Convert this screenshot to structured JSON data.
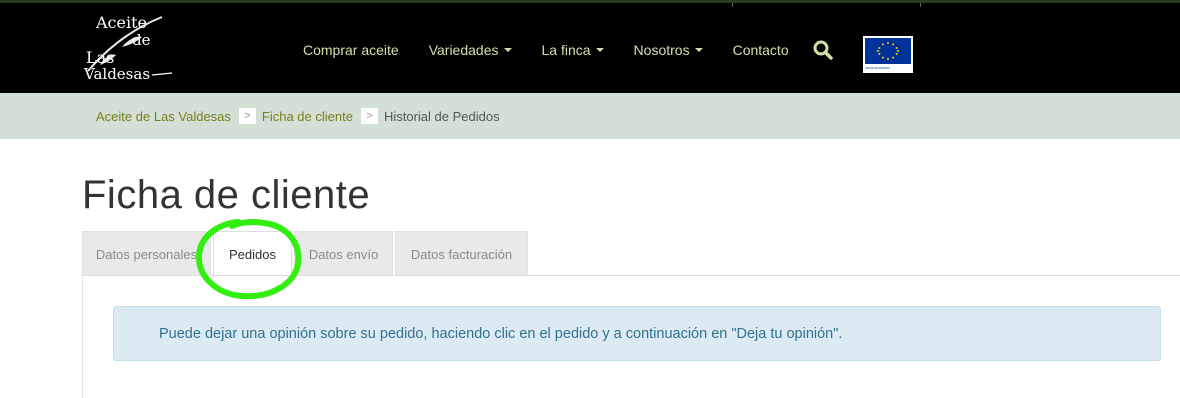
{
  "logo": {
    "line1": "Aceite",
    "line2": "de",
    "line3": "Las",
    "line4": "Valdesas"
  },
  "nav": {
    "items": [
      {
        "label": "Comprar aceite",
        "dropdown": false
      },
      {
        "label": "Variedades",
        "dropdown": true
      },
      {
        "label": "La finca",
        "dropdown": true
      },
      {
        "label": "Nosotros",
        "dropdown": true
      },
      {
        "label": "Contacto",
        "dropdown": false
      }
    ],
    "search_icon": "search-icon",
    "eu_caption": "UNIÓN EUROPEA"
  },
  "breadcrumb": {
    "items": [
      {
        "label": "Aceite de Las Valdesas",
        "link": true
      },
      {
        "label": "Ficha de cliente",
        "link": true
      },
      {
        "label": "Historial de Pedidos",
        "link": false
      }
    ],
    "separator": ">"
  },
  "page": {
    "title": "Ficha de cliente"
  },
  "tabs": [
    {
      "label": "Datos personales",
      "active": false
    },
    {
      "label": "Pedidos",
      "active": true
    },
    {
      "label": "Datos envío",
      "active": false
    },
    {
      "label": "Datos facturación",
      "active": false
    }
  ],
  "alert": {
    "text": "Puede dejar una opinión sobre su pedido, haciendo clic en el pedido y a continuación en \"Deja tu opinión\"."
  },
  "colors": {
    "topbar": "#000000",
    "nav_text": "#cfe0a8",
    "breadcrumb_bg": "#d3e0d6",
    "breadcrumb_link": "#7a7d1e",
    "alert_bg": "#dcebf3",
    "alert_text": "#33708f",
    "highlight": "#33ee11"
  }
}
